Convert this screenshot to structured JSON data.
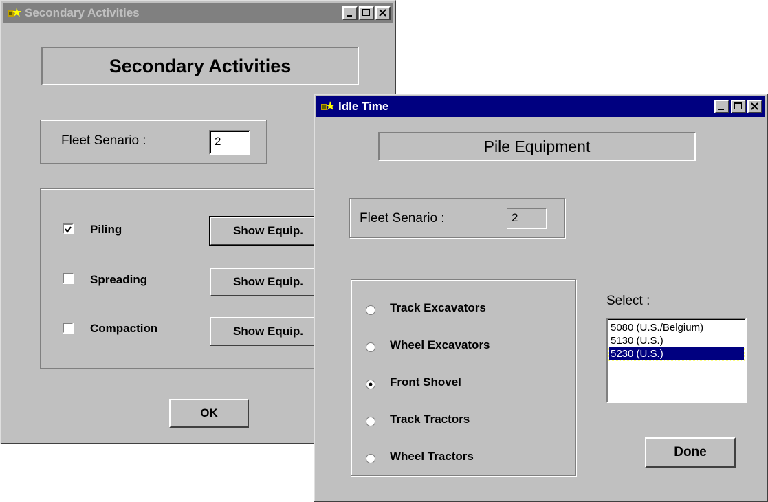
{
  "secondary_window": {
    "title": "Secondary Activities",
    "heading": "Secondary Activities",
    "fleet_label": "Fleet Senario  :",
    "fleet_value": "2",
    "activities": [
      {
        "label": "Piling",
        "checked": true,
        "button": "Show Equip."
      },
      {
        "label": "Spreading",
        "checked": false,
        "button": "Show Equip."
      },
      {
        "label": "Compaction",
        "checked": false,
        "button": "Show Equip."
      }
    ],
    "ok_label": "OK"
  },
  "idle_window": {
    "title": "Idle Time",
    "heading": "Pile Equipment",
    "fleet_label": "Fleet Senario :",
    "fleet_value": "2",
    "equipment_options": [
      {
        "label": "Track Excavators",
        "selected": false
      },
      {
        "label": "Wheel Excavators",
        "selected": false
      },
      {
        "label": "Front Shovel",
        "selected": true
      },
      {
        "label": "Track Tractors",
        "selected": false
      },
      {
        "label": "Wheel Tractors",
        "selected": false
      }
    ],
    "select_label": "Select :",
    "models": [
      {
        "label": "5080 (U.S./Belgium)",
        "selected": false
      },
      {
        "label": "5130 (U.S.)",
        "selected": false
      },
      {
        "label": "5230 (U.S.)",
        "selected": true
      }
    ],
    "done_label": "Done"
  },
  "colors": {
    "face": "#c0c0c0",
    "active_title": "#000080",
    "inactive_title": "#808080"
  }
}
